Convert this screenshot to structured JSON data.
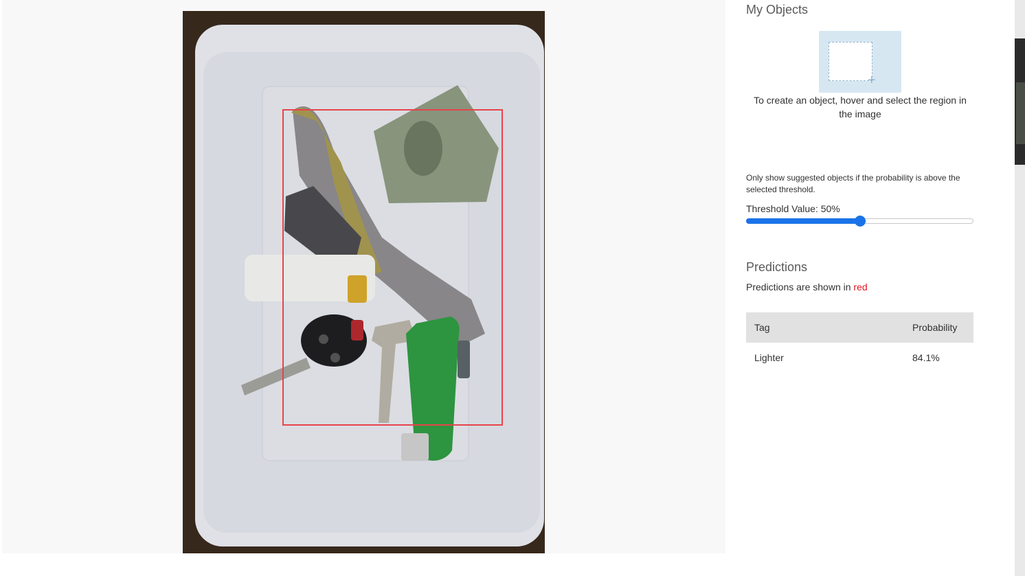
{
  "objects_panel": {
    "title": "My Objects",
    "hint": "To create an object, hover and select the region in the image"
  },
  "threshold": {
    "note": "Only show suggested objects if the probability is above the selected threshold.",
    "label": "Threshold Value: 50%",
    "value_percent": 50
  },
  "predictions": {
    "title": "Predictions",
    "subtitle_prefix": "Predictions are shown in ",
    "subtitle_color_word": "red",
    "columns": [
      "Tag",
      "Probability"
    ],
    "rows": [
      {
        "tag": "Lighter",
        "probability": "84.1%"
      }
    ]
  },
  "colors": {
    "prediction_box": "#e8434b",
    "slider_accent": "#1a73e8",
    "object_tile": "#d7e7f2"
  },
  "icons": {
    "add_object": "plus-icon"
  }
}
